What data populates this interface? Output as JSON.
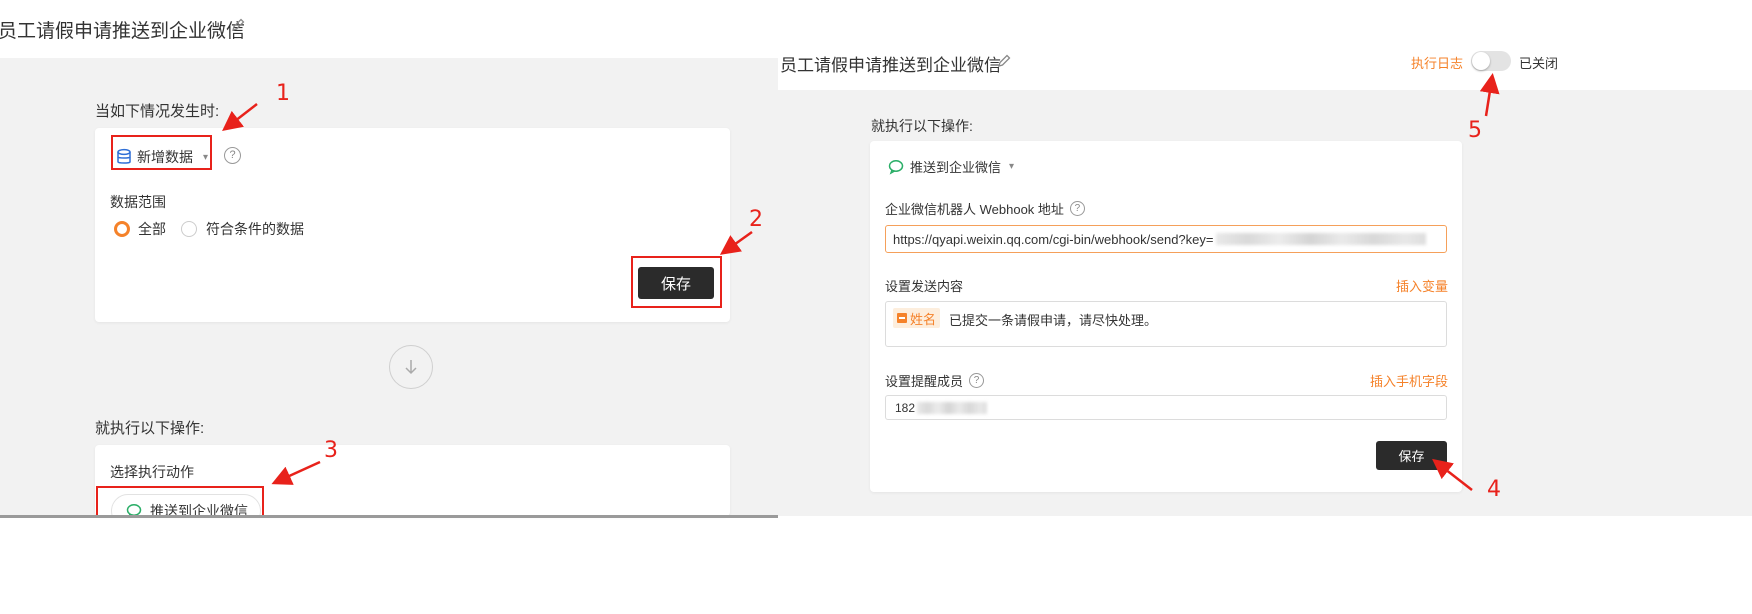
{
  "left": {
    "page_title": "员工请假申请推送到企业微信",
    "trigger_section_title": "当如下情况发生时:",
    "trigger_select_label": "新增数据",
    "data_range_label": "数据范围",
    "range_options": [
      "全部",
      "符合条件的数据"
    ],
    "save_label": "保存",
    "action_section_title": "就执行以下操作:",
    "choose_action_label": "选择执行动作",
    "action_chip_label": "推送到企业微信"
  },
  "right": {
    "page_title": "员工请假申请推送到企业微信",
    "exec_log_label": "执行日志",
    "toggle_status": "已关闭",
    "action_section_title": "就执行以下操作:",
    "action_select_label": "推送到企业微信",
    "webhook_label": "企业微信机器人 Webhook 地址",
    "webhook_value": "https://qyapi.weixin.qq.com/cgi-bin/webhook/send?key=",
    "content_label": "设置发送内容",
    "insert_variable_label": "插入变量",
    "content_tag": "姓名",
    "content_text": "已提交一条请假申请，请尽快处理。",
    "remind_label": "设置提醒成员",
    "insert_phone_label": "插入手机字段",
    "phone_value": "182",
    "save_label": "保存"
  },
  "annotations": [
    "1",
    "2",
    "3",
    "4",
    "5"
  ],
  "colors": {
    "accent_orange": "#f5822a",
    "annotation_red": "#e8221b",
    "button_dark": "#2b2b2b",
    "wechat_green": "#2aae67",
    "db_blue": "#2f6fd6"
  }
}
